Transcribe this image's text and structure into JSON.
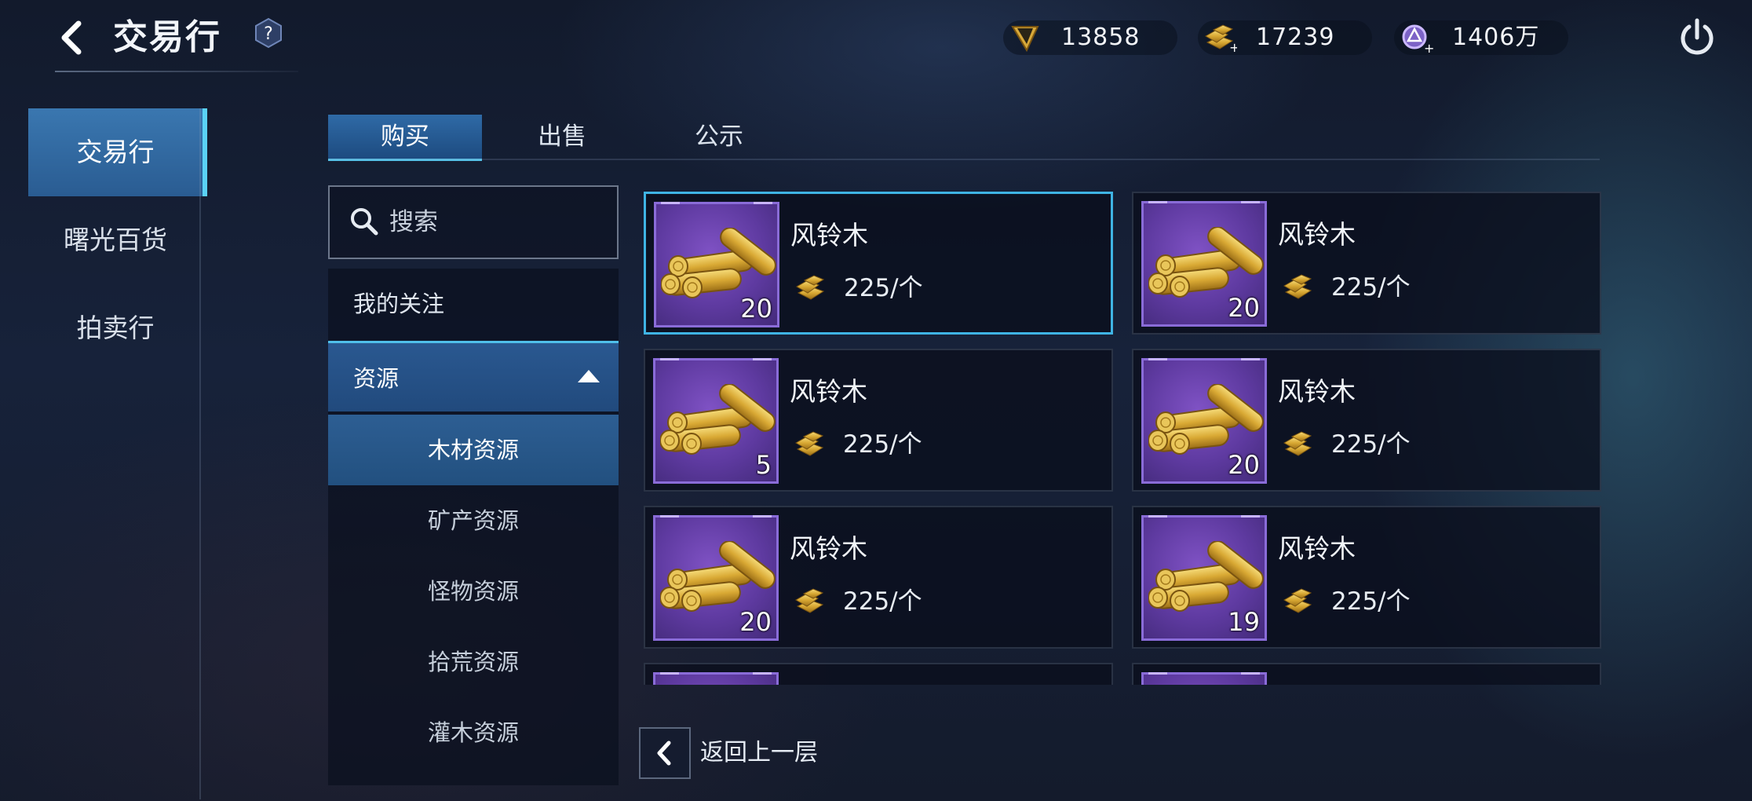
{
  "header": {
    "title": "交易行",
    "help_label": "?"
  },
  "currencies": [
    {
      "icon": "diamond-icon",
      "value": "13858"
    },
    {
      "icon": "gold-bar-icon",
      "value": "17239"
    },
    {
      "icon": "crystal-coin-icon",
      "value": "1406万"
    }
  ],
  "nav": {
    "items": [
      {
        "label": "交易行",
        "active": true
      },
      {
        "label": "曙光百货",
        "active": false
      },
      {
        "label": "拍卖行",
        "active": false
      }
    ]
  },
  "tabs": [
    {
      "label": "购买",
      "active": true
    },
    {
      "label": "出售",
      "active": false
    },
    {
      "label": "公示",
      "active": false
    }
  ],
  "search": {
    "placeholder": "搜索"
  },
  "categories": {
    "favorites": "我的关注",
    "resources": "资源",
    "subs": [
      "木材资源",
      "矿产资源",
      "怪物资源",
      "拾荒资源",
      "灌木资源"
    ],
    "selected_sub": "木材资源"
  },
  "items": [
    {
      "name": "风铃木",
      "price": "225/个",
      "qty": "20"
    },
    {
      "name": "风铃木",
      "price": "225/个",
      "qty": "20"
    },
    {
      "name": "风铃木",
      "price": "225/个",
      "qty": "5"
    },
    {
      "name": "风铃木",
      "price": "225/个",
      "qty": "20"
    },
    {
      "name": "风铃木",
      "price": "225/个",
      "qty": "20"
    },
    {
      "name": "风铃木",
      "price": "225/个",
      "qty": "19"
    }
  ],
  "footer": {
    "back_label": "返回上一层"
  },
  "colors": {
    "accent": "#3fb4e4",
    "item_bg": "#5e3aa0",
    "gold": "#e0b53a"
  }
}
